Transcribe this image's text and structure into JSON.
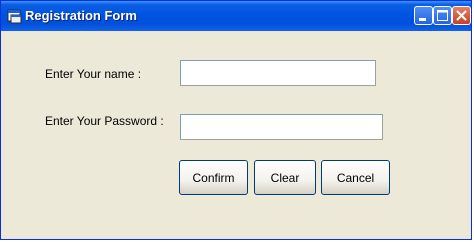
{
  "window": {
    "title": "Registration Form",
    "controls": {
      "minimize": "minimize",
      "maximize": "maximize",
      "close": "close"
    }
  },
  "form": {
    "name_label": "Enter Your name :",
    "name_value": "",
    "password_label": "Enter Your Password :",
    "password_value": ""
  },
  "buttons": {
    "confirm": "Confirm",
    "clear": "Clear",
    "cancel": "Cancel"
  },
  "colors": {
    "titlebar": "#0053e1",
    "client_bg": "#ece9d8",
    "close_button": "#c8401f"
  }
}
